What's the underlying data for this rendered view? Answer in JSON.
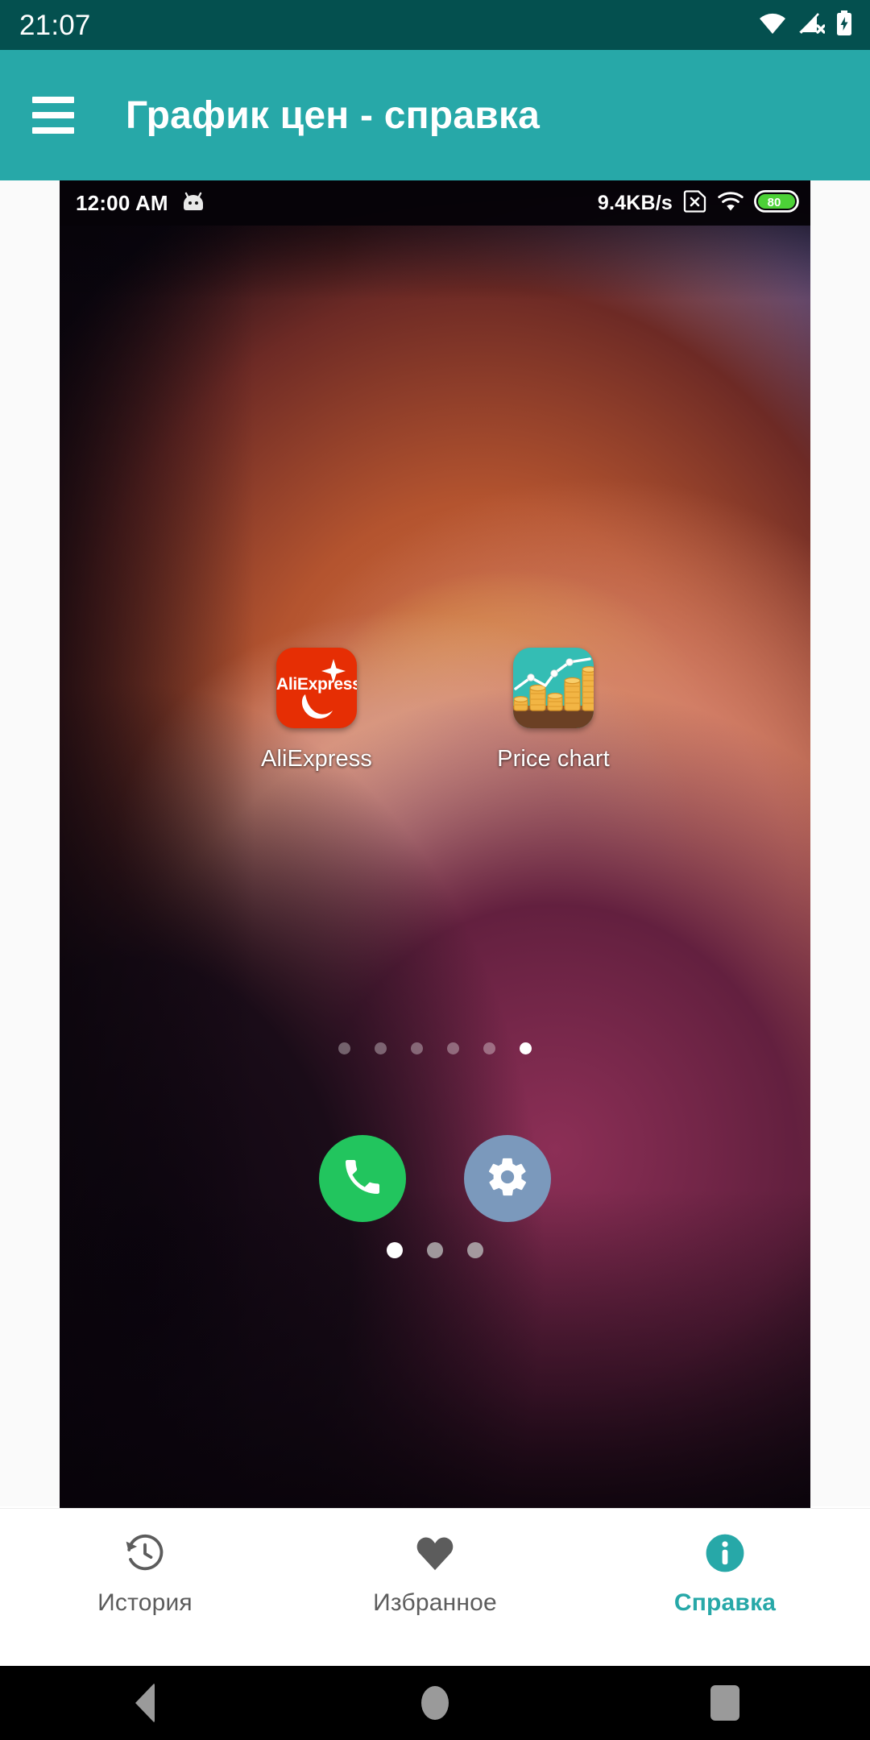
{
  "system_status_bar": {
    "clock": "21:07",
    "icons": [
      "wifi-icon",
      "signal-no-sim-icon",
      "battery-charging-icon"
    ],
    "background_color": "#04504F"
  },
  "app_bar": {
    "menu_icon": "hamburger-menu-icon",
    "title": "График цен - справка",
    "background_color": "#27A8A8",
    "text_color": "#FFFFFF"
  },
  "screenshot": {
    "status_bar": {
      "time": "12:00 AM",
      "mascot_icon": "android-head-icon",
      "network_speed": "9.4KB/s",
      "no_sim_icon": "no-sim-card-icon",
      "wifi_icon": "wifi-icon",
      "battery_level": "80",
      "battery_color": "#4CD137"
    },
    "apps": [
      {
        "label": "AliExpress",
        "icon": "aliexpress-icon",
        "icon_color": "#E62E04"
      },
      {
        "label": "Price chart",
        "icon": "price-chart-icon",
        "icon_color": "#34BDB4"
      }
    ],
    "page_indicator": {
      "count": 6,
      "active_index": 5
    },
    "dock": [
      {
        "name": "phone",
        "icon": "phone-icon",
        "color": "#22C55E"
      },
      {
        "name": "settings",
        "icon": "gear-icon",
        "color": "#7B99BC"
      }
    ],
    "dock_page_indicator": {
      "count": 3,
      "active_index": 0
    },
    "wallpaper": "slot-canyon-photo"
  },
  "bottom_nav": {
    "active_color": "#27A8A8",
    "inactive_color": "#5C5C5C",
    "items": [
      {
        "label": "История",
        "icon": "history-icon",
        "active": false
      },
      {
        "label": "Избранное",
        "icon": "heart-icon",
        "active": false
      },
      {
        "label": "Справка",
        "icon": "info-circle-icon",
        "active": true
      }
    ]
  },
  "android_nav_bar": {
    "buttons": [
      "back-icon",
      "home-icon",
      "recents-icon"
    ],
    "background_color": "#000000"
  }
}
